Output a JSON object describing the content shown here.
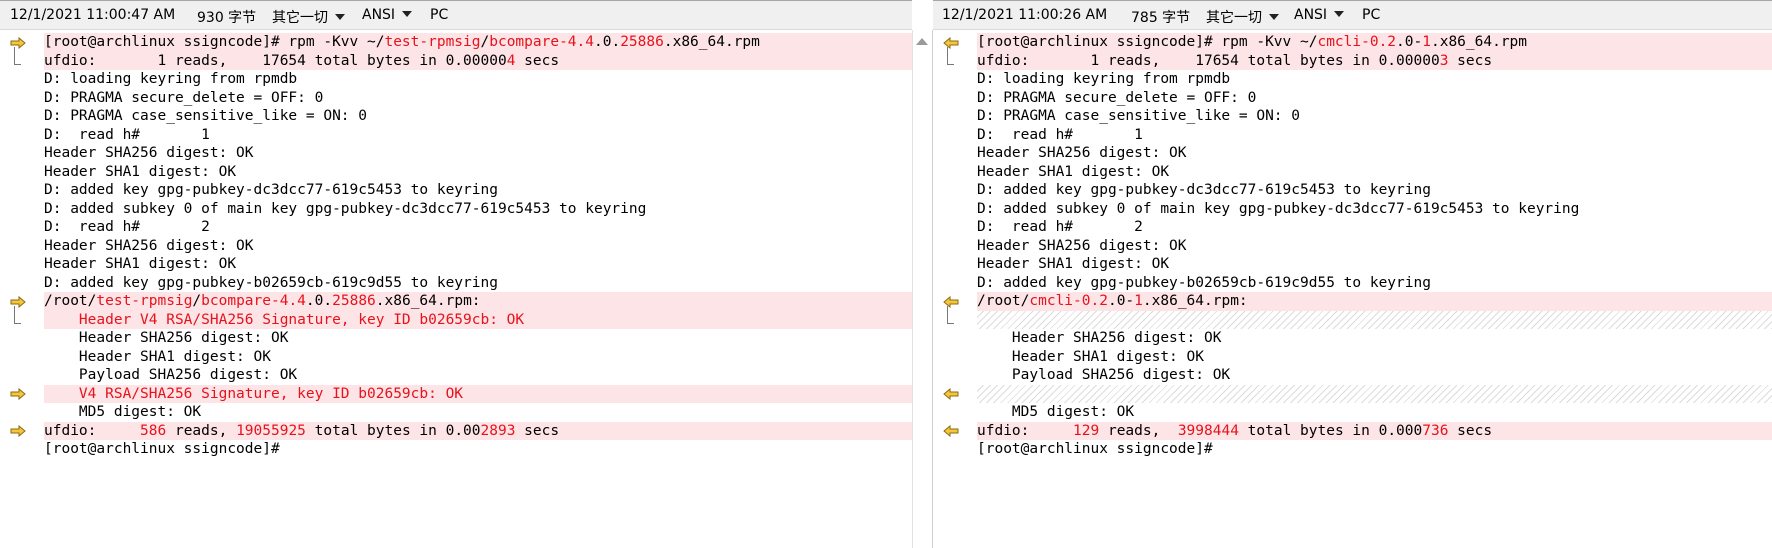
{
  "left": {
    "status": {
      "datetime": "12/1/2021 11:00:47 AM",
      "size": "930 字节",
      "filter": "其它一切",
      "encoding": "ANSI",
      "lineend": "PC"
    },
    "lines": [
      {
        "kind": "changed",
        "arrow": true,
        "parts": [
          {
            "t": "[root@archlinux ssigncode]# rpm -Kvv ~/"
          },
          {
            "t": "test-rpmsig",
            "h": true
          },
          {
            "t": "/"
          },
          {
            "t": "bcompare-4.4",
            "h": true
          },
          {
            "t": ".0."
          },
          {
            "t": "25886",
            "h": true
          },
          {
            "t": ".x86_64.rpm"
          }
        ]
      },
      {
        "kind": "changed",
        "parts": [
          {
            "t": "ufdio:       1 reads,    17654 total bytes in 0.00000"
          },
          {
            "t": "4",
            "h": true
          },
          {
            "t": " secs"
          }
        ]
      },
      {
        "kind": "normal",
        "parts": [
          {
            "t": "D: loading keyring from rpmdb"
          }
        ]
      },
      {
        "kind": "normal",
        "parts": [
          {
            "t": "D: PRAGMA secure_delete = OFF: 0"
          }
        ]
      },
      {
        "kind": "normal",
        "parts": [
          {
            "t": "D: PRAGMA case_sensitive_like = ON: 0"
          }
        ]
      },
      {
        "kind": "normal",
        "parts": [
          {
            "t": "D:  read h#       1"
          }
        ]
      },
      {
        "kind": "normal",
        "parts": [
          {
            "t": "Header SHA256 digest: OK"
          }
        ]
      },
      {
        "kind": "normal",
        "parts": [
          {
            "t": "Header SHA1 digest: OK"
          }
        ]
      },
      {
        "kind": "normal",
        "parts": [
          {
            "t": "D: added key gpg-pubkey-dc3dcc77-619c5453 to keyring"
          }
        ]
      },
      {
        "kind": "normal",
        "parts": [
          {
            "t": "D: added subkey 0 of main key gpg-pubkey-dc3dcc77-619c5453 to keyring"
          }
        ]
      },
      {
        "kind": "normal",
        "parts": [
          {
            "t": "D:  read h#       2"
          }
        ]
      },
      {
        "kind": "normal",
        "parts": [
          {
            "t": "Header SHA256 digest: OK"
          }
        ]
      },
      {
        "kind": "normal",
        "parts": [
          {
            "t": "Header SHA1 digest: OK"
          }
        ]
      },
      {
        "kind": "normal",
        "parts": [
          {
            "t": "D: added key gpg-pubkey-b02659cb-619c9d55 to keyring"
          }
        ]
      },
      {
        "kind": "changed",
        "arrow": true,
        "parts": [
          {
            "t": "/root/"
          },
          {
            "t": "test-rpmsig",
            "h": true
          },
          {
            "t": "/"
          },
          {
            "t": "bcompare-4.4",
            "h": true
          },
          {
            "t": ".0."
          },
          {
            "t": "25886",
            "h": true
          },
          {
            "t": ".x86_64.rpm:"
          }
        ]
      },
      {
        "kind": "changed",
        "parts": [
          {
            "t": "    Header V4 RSA/SHA256 Signature, key ID b02659cb: OK",
            "h": true
          }
        ]
      },
      {
        "kind": "normal",
        "parts": [
          {
            "t": "    Header SHA256 digest: OK"
          }
        ]
      },
      {
        "kind": "normal",
        "parts": [
          {
            "t": "    Header SHA1 digest: OK"
          }
        ]
      },
      {
        "kind": "normal",
        "parts": [
          {
            "t": "    Payload SHA256 digest: OK"
          }
        ]
      },
      {
        "kind": "changed",
        "arrow": true,
        "parts": [
          {
            "t": "    V4 RSA/SHA256 Signature, key ID b02659cb: OK",
            "h": true
          }
        ]
      },
      {
        "kind": "normal",
        "parts": [
          {
            "t": "    MD5 digest: OK"
          }
        ]
      },
      {
        "kind": "changed",
        "arrow": true,
        "parts": [
          {
            "t": "ufdio:     "
          },
          {
            "t": "586",
            "h": true
          },
          {
            "t": " reads, "
          },
          {
            "t": "19055925",
            "h": true
          },
          {
            "t": " total bytes in 0.00"
          },
          {
            "t": "2893",
            "h": true
          },
          {
            "t": " secs"
          }
        ]
      },
      {
        "kind": "normal",
        "parts": [
          {
            "t": "[root@archlinux ssigncode]#"
          }
        ]
      }
    ]
  },
  "right": {
    "status": {
      "datetime": "12/1/2021 11:00:26 AM",
      "size": "785 字节",
      "filter": "其它一切",
      "encoding": "ANSI",
      "lineend": "PC"
    },
    "lines": [
      {
        "kind": "changed",
        "arrow": true,
        "parts": [
          {
            "t": "[root@archlinux ssigncode]# rpm -Kvv ~/"
          },
          {
            "t": "cmcli-0.2",
            "h": true
          },
          {
            "t": ".0-"
          },
          {
            "t": "1",
            "h": true
          },
          {
            "t": ".x86_64.rpm"
          }
        ]
      },
      {
        "kind": "changed",
        "parts": [
          {
            "t": "ufdio:       1 reads,    17654 total bytes in 0.00000"
          },
          {
            "t": "3",
            "h": true
          },
          {
            "t": " secs"
          }
        ]
      },
      {
        "kind": "normal",
        "parts": [
          {
            "t": "D: loading keyring from rpmdb"
          }
        ]
      },
      {
        "kind": "normal",
        "parts": [
          {
            "t": "D: PRAGMA secure_delete = OFF: 0"
          }
        ]
      },
      {
        "kind": "normal",
        "parts": [
          {
            "t": "D: PRAGMA case_sensitive_like = ON: 0"
          }
        ]
      },
      {
        "kind": "normal",
        "parts": [
          {
            "t": "D:  read h#       1"
          }
        ]
      },
      {
        "kind": "normal",
        "parts": [
          {
            "t": "Header SHA256 digest: OK"
          }
        ]
      },
      {
        "kind": "normal",
        "parts": [
          {
            "t": "Header SHA1 digest: OK"
          }
        ]
      },
      {
        "kind": "normal",
        "parts": [
          {
            "t": "D: added key gpg-pubkey-dc3dcc77-619c5453 to keyring"
          }
        ]
      },
      {
        "kind": "normal",
        "parts": [
          {
            "t": "D: added subkey 0 of main key gpg-pubkey-dc3dcc77-619c5453 to keyring"
          }
        ]
      },
      {
        "kind": "normal",
        "parts": [
          {
            "t": "D:  read h#       2"
          }
        ]
      },
      {
        "kind": "normal",
        "parts": [
          {
            "t": "Header SHA256 digest: OK"
          }
        ]
      },
      {
        "kind": "normal",
        "parts": [
          {
            "t": "Header SHA1 digest: OK"
          }
        ]
      },
      {
        "kind": "normal",
        "parts": [
          {
            "t": "D: added key gpg-pubkey-b02659cb-619c9d55 to keyring"
          }
        ]
      },
      {
        "kind": "changed",
        "arrow": true,
        "parts": [
          {
            "t": "/root/"
          },
          {
            "t": "cmcli-0.2",
            "h": true
          },
          {
            "t": ".0-"
          },
          {
            "t": "1",
            "h": true
          },
          {
            "t": ".x86_64.rpm:"
          }
        ]
      },
      {
        "kind": "missing",
        "parts": []
      },
      {
        "kind": "normal",
        "parts": [
          {
            "t": "    Header SHA256 digest: OK"
          }
        ]
      },
      {
        "kind": "normal",
        "parts": [
          {
            "t": "    Header SHA1 digest: OK"
          }
        ]
      },
      {
        "kind": "normal",
        "parts": [
          {
            "t": "    Payload SHA256 digest: OK"
          }
        ]
      },
      {
        "kind": "missing",
        "arrow": true,
        "parts": []
      },
      {
        "kind": "normal",
        "parts": [
          {
            "t": "    MD5 digest: OK"
          }
        ]
      },
      {
        "kind": "changed",
        "arrow": true,
        "parts": [
          {
            "t": "ufdio:     "
          },
          {
            "t": "129",
            "h": true
          },
          {
            "t": " reads,  "
          },
          {
            "t": "3998444",
            "h": true
          },
          {
            "t": " total bytes in 0.000"
          },
          {
            "t": "736",
            "h": true
          },
          {
            "t": " secs"
          }
        ]
      },
      {
        "kind": "normal",
        "parts": [
          {
            "t": "[root@archlinux ssigncode]#"
          }
        ]
      }
    ]
  }
}
